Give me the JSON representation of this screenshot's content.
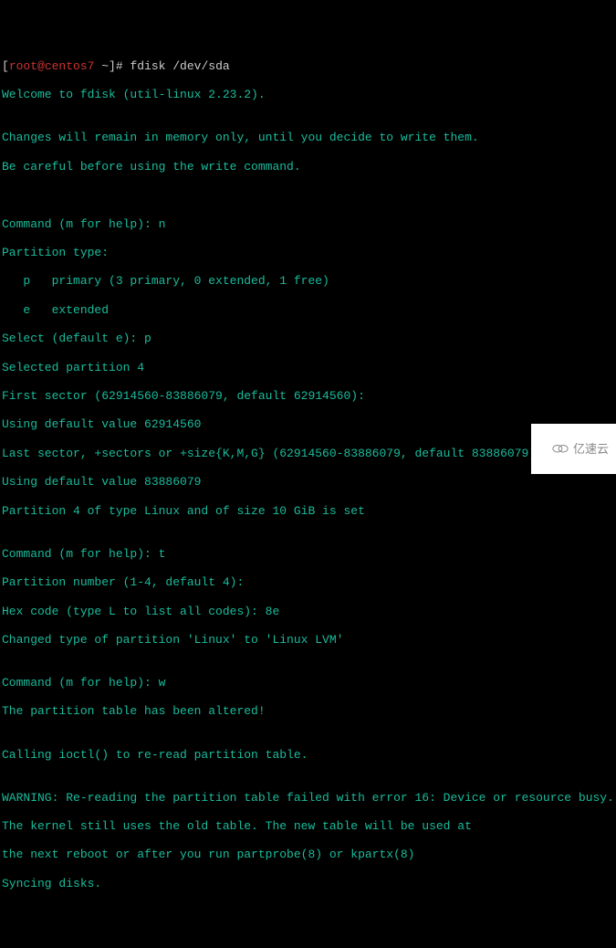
{
  "prompt": {
    "user_host": "root@centos7",
    "open_bracket": "[",
    "close_bracket_path": " ~]# ",
    "command": "fdisk /dev/sda"
  },
  "lines": {
    "l01": "Welcome to fdisk (util-linux 2.23.2).",
    "l02": "",
    "l03": "Changes will remain in memory only, until you decide to write them.",
    "l04": "Be careful before using the write command.",
    "l05": "",
    "l06": "",
    "l07": "Command (m for help): n",
    "l08": "Partition type:",
    "l09": "   p   primary (3 primary, 0 extended, 1 free)",
    "l10": "   e   extended",
    "l11": "Select (default e): p",
    "l12": "Selected partition 4",
    "l13": "First sector (62914560-83886079, default 62914560):",
    "l14": "Using default value 62914560",
    "l15": "Last sector, +sectors or +size{K,M,G} (62914560-83886079, default 83886079):",
    "l16": "Using default value 83886079",
    "l17": "Partition 4 of type Linux and of size 10 GiB is set",
    "l18": "",
    "l19": "Command (m for help): t",
    "l20": "Partition number (1-4, default 4):",
    "l21": "Hex code (type L to list all codes): 8e",
    "l22": "Changed type of partition 'Linux' to 'Linux LVM'",
    "l23": "",
    "l24": "Command (m for help): w",
    "l25": "The partition table has been altered!",
    "l26": "",
    "l27": "Calling ioctl() to re-read partition table.",
    "l28": "",
    "l29": "WARNING: Re-reading the partition table failed with error 16: Device or resource busy.",
    "l30": "The kernel still uses the old table. The new table will be used at",
    "l31": "the next reboot or after you run partprobe(8) or kpartx(8)",
    "l32": "Syncing disks."
  },
  "watermark": {
    "text": "亿速云"
  }
}
